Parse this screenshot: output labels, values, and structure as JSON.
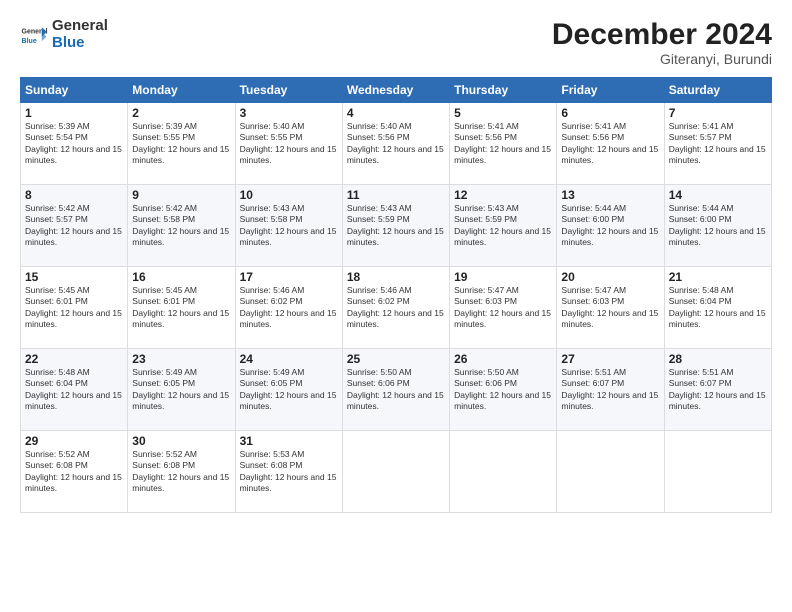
{
  "logo": {
    "general": "General",
    "blue": "Blue"
  },
  "header": {
    "month": "December 2024",
    "location": "Giteranyi, Burundi"
  },
  "days_of_week": [
    "Sunday",
    "Monday",
    "Tuesday",
    "Wednesday",
    "Thursday",
    "Friday",
    "Saturday"
  ],
  "weeks": [
    [
      {
        "day": "1",
        "sunrise": "5:39 AM",
        "sunset": "5:54 PM",
        "daylight": "12 hours and 15 minutes."
      },
      {
        "day": "2",
        "sunrise": "5:39 AM",
        "sunset": "5:55 PM",
        "daylight": "12 hours and 15 minutes."
      },
      {
        "day": "3",
        "sunrise": "5:40 AM",
        "sunset": "5:55 PM",
        "daylight": "12 hours and 15 minutes."
      },
      {
        "day": "4",
        "sunrise": "5:40 AM",
        "sunset": "5:56 PM",
        "daylight": "12 hours and 15 minutes."
      },
      {
        "day": "5",
        "sunrise": "5:41 AM",
        "sunset": "5:56 PM",
        "daylight": "12 hours and 15 minutes."
      },
      {
        "day": "6",
        "sunrise": "5:41 AM",
        "sunset": "5:56 PM",
        "daylight": "12 hours and 15 minutes."
      },
      {
        "day": "7",
        "sunrise": "5:41 AM",
        "sunset": "5:57 PM",
        "daylight": "12 hours and 15 minutes."
      }
    ],
    [
      {
        "day": "8",
        "sunrise": "5:42 AM",
        "sunset": "5:57 PM",
        "daylight": "12 hours and 15 minutes."
      },
      {
        "day": "9",
        "sunrise": "5:42 AM",
        "sunset": "5:58 PM",
        "daylight": "12 hours and 15 minutes."
      },
      {
        "day": "10",
        "sunrise": "5:43 AM",
        "sunset": "5:58 PM",
        "daylight": "12 hours and 15 minutes."
      },
      {
        "day": "11",
        "sunrise": "5:43 AM",
        "sunset": "5:59 PM",
        "daylight": "12 hours and 15 minutes."
      },
      {
        "day": "12",
        "sunrise": "5:43 AM",
        "sunset": "5:59 PM",
        "daylight": "12 hours and 15 minutes."
      },
      {
        "day": "13",
        "sunrise": "5:44 AM",
        "sunset": "6:00 PM",
        "daylight": "12 hours and 15 minutes."
      },
      {
        "day": "14",
        "sunrise": "5:44 AM",
        "sunset": "6:00 PM",
        "daylight": "12 hours and 15 minutes."
      }
    ],
    [
      {
        "day": "15",
        "sunrise": "5:45 AM",
        "sunset": "6:01 PM",
        "daylight": "12 hours and 15 minutes."
      },
      {
        "day": "16",
        "sunrise": "5:45 AM",
        "sunset": "6:01 PM",
        "daylight": "12 hours and 15 minutes."
      },
      {
        "day": "17",
        "sunrise": "5:46 AM",
        "sunset": "6:02 PM",
        "daylight": "12 hours and 15 minutes."
      },
      {
        "day": "18",
        "sunrise": "5:46 AM",
        "sunset": "6:02 PM",
        "daylight": "12 hours and 15 minutes."
      },
      {
        "day": "19",
        "sunrise": "5:47 AM",
        "sunset": "6:03 PM",
        "daylight": "12 hours and 15 minutes."
      },
      {
        "day": "20",
        "sunrise": "5:47 AM",
        "sunset": "6:03 PM",
        "daylight": "12 hours and 15 minutes."
      },
      {
        "day": "21",
        "sunrise": "5:48 AM",
        "sunset": "6:04 PM",
        "daylight": "12 hours and 15 minutes."
      }
    ],
    [
      {
        "day": "22",
        "sunrise": "5:48 AM",
        "sunset": "6:04 PM",
        "daylight": "12 hours and 15 minutes."
      },
      {
        "day": "23",
        "sunrise": "5:49 AM",
        "sunset": "6:05 PM",
        "daylight": "12 hours and 15 minutes."
      },
      {
        "day": "24",
        "sunrise": "5:49 AM",
        "sunset": "6:05 PM",
        "daylight": "12 hours and 15 minutes."
      },
      {
        "day": "25",
        "sunrise": "5:50 AM",
        "sunset": "6:06 PM",
        "daylight": "12 hours and 15 minutes."
      },
      {
        "day": "26",
        "sunrise": "5:50 AM",
        "sunset": "6:06 PM",
        "daylight": "12 hours and 15 minutes."
      },
      {
        "day": "27",
        "sunrise": "5:51 AM",
        "sunset": "6:07 PM",
        "daylight": "12 hours and 15 minutes."
      },
      {
        "day": "28",
        "sunrise": "5:51 AM",
        "sunset": "6:07 PM",
        "daylight": "12 hours and 15 minutes."
      }
    ],
    [
      {
        "day": "29",
        "sunrise": "5:52 AM",
        "sunset": "6:08 PM",
        "daylight": "12 hours and 15 minutes."
      },
      {
        "day": "30",
        "sunrise": "5:52 AM",
        "sunset": "6:08 PM",
        "daylight": "12 hours and 15 minutes."
      },
      {
        "day": "31",
        "sunrise": "5:53 AM",
        "sunset": "6:08 PM",
        "daylight": "12 hours and 15 minutes."
      },
      null,
      null,
      null,
      null
    ]
  ],
  "labels": {
    "sunrise": "Sunrise:",
    "sunset": "Sunset:",
    "daylight": "Daylight: "
  }
}
